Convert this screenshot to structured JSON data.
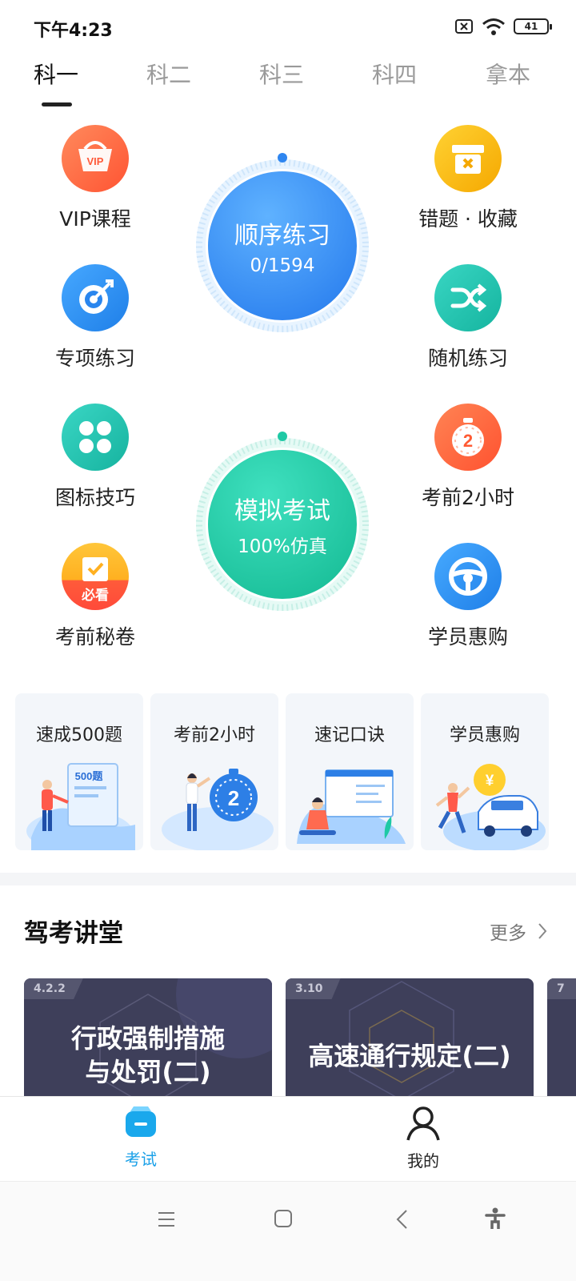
{
  "status": {
    "time": "下午4:23",
    "battery": "41"
  },
  "tabs": [
    {
      "label": "科一",
      "active": true
    },
    {
      "label": "科二",
      "active": false
    },
    {
      "label": "科三",
      "active": false
    },
    {
      "label": "科四",
      "active": false
    },
    {
      "label": "拿本",
      "active": false
    }
  ],
  "features_left": [
    {
      "label": "VIP课程",
      "icon": "vip-icon",
      "color": "#ff6b4a"
    },
    {
      "label": "专项练习",
      "icon": "target-icon",
      "color": "#2e8ff0"
    },
    {
      "label": "图标技巧",
      "icon": "grid-icon",
      "color": "#22c4b2"
    },
    {
      "label": "考前秘卷",
      "icon": "exam-paper-icon",
      "color": "#f5a623"
    }
  ],
  "features_right": [
    {
      "label": "错题 · 收藏",
      "icon": "error-box-icon",
      "color": "#f7b500"
    },
    {
      "label": "随机练习",
      "icon": "shuffle-icon",
      "color": "#22c4b2"
    },
    {
      "label": "考前2小时",
      "icon": "stopwatch-icon",
      "color": "#ff6b4a"
    },
    {
      "label": "学员惠购",
      "icon": "steering-wheel-icon",
      "color": "#2e8ff0"
    }
  ],
  "sequential": {
    "title": "顺序练习",
    "progress": "0/1594",
    "progress_fraction": 0,
    "color": "#2f86f0"
  },
  "mock_exam": {
    "title": "模拟考试",
    "subtitle": "100%仿真",
    "color": "#1ec9a5"
  },
  "vip_badge": "VIP",
  "must_see_badge": "必看",
  "stopwatch_digit": "2",
  "promo_cards": [
    {
      "title": "速成500题",
      "illustration_text": "500题"
    },
    {
      "title": "考前2小时",
      "illustration_text": "2"
    },
    {
      "title": "速记口诀",
      "illustration_text": ""
    },
    {
      "title": "学员惠购",
      "illustration_text": "¥"
    }
  ],
  "lecture": {
    "title": "驾考讲堂",
    "more": "更多",
    "items": [
      {
        "tag": "4.2.2",
        "title_line1": "行政强制措施",
        "title_line2": "与处罚(二)"
      },
      {
        "tag": "3.10",
        "title_line1": "高速通行规定(二)",
        "title_line2": ""
      },
      {
        "tag": "7",
        "title_line1": "",
        "title_line2": ""
      }
    ]
  },
  "bottom_nav": [
    {
      "label": "考试",
      "active": true,
      "icon": "exam-bag-icon"
    },
    {
      "label": "我的",
      "active": false,
      "icon": "person-icon"
    }
  ],
  "colors": {
    "accent": "#1aa0e8",
    "text": "#222222",
    "muted": "#9a9a9a"
  }
}
